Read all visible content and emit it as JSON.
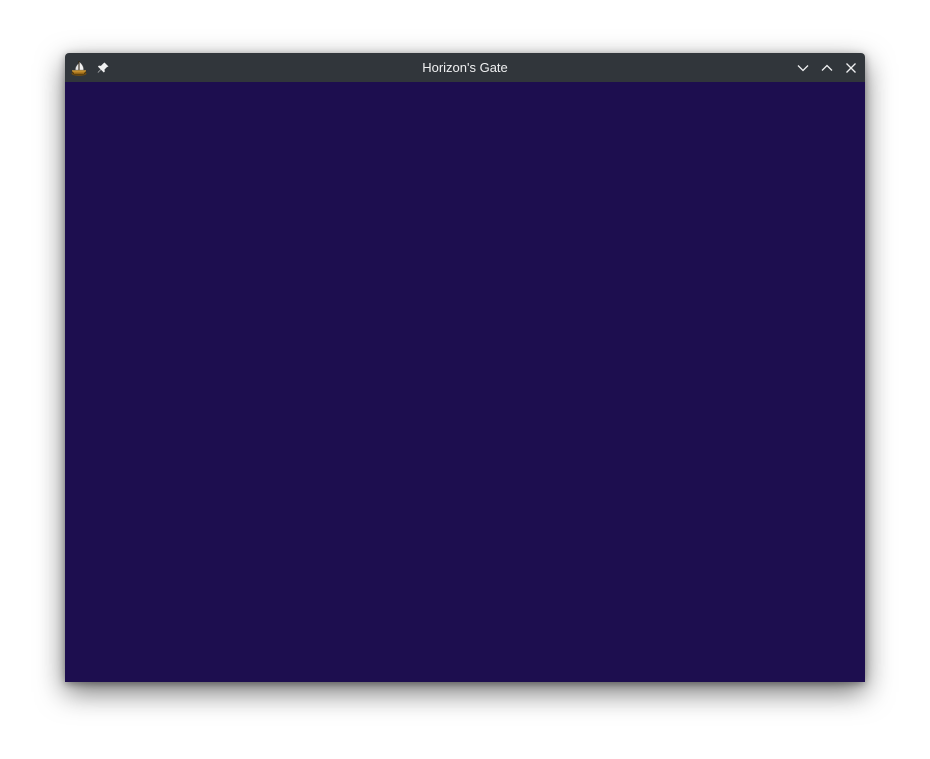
{
  "window": {
    "title": "Horizon's Gate",
    "app_icon": "ship-icon",
    "controls": {
      "pin": "pin-icon",
      "minimize": "chevron-down-icon",
      "maximize": "chevron-up-icon",
      "close": "close-icon"
    }
  },
  "colors": {
    "titlebar": "#31363b",
    "title_text": "#eff0f1",
    "game_background": "#1d0e4f"
  }
}
